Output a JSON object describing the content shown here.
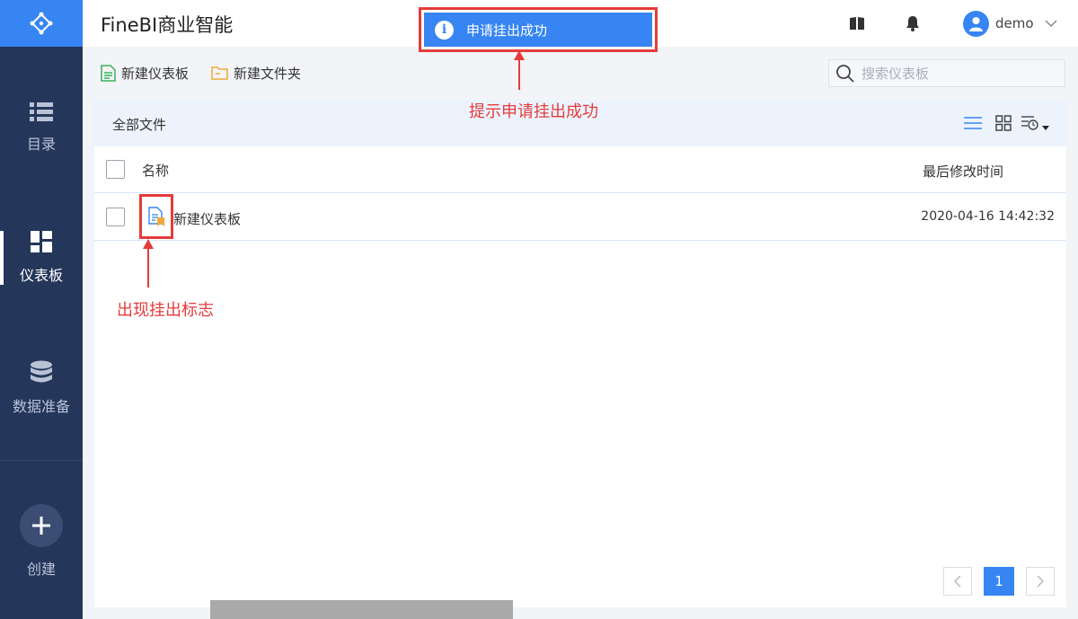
{
  "app": {
    "title": "FineBI商业智能",
    "brand_color": "#3685f2",
    "sidebar_color": "#24365a"
  },
  "sidebar": {
    "logo_icon": "finebi-logo-icon",
    "items": [
      {
        "label": "目录",
        "icon": "list-icon",
        "active": false
      },
      {
        "label": "仪表板",
        "icon": "dashboard-grid-icon",
        "active": true
      },
      {
        "label": "数据准备",
        "icon": "database-icon",
        "active": false
      }
    ],
    "create_label": "创建"
  },
  "header": {
    "help_icon": "book-icon",
    "bell_icon": "bell-icon",
    "username": "demo"
  },
  "toast": {
    "text": "申请挂出成功",
    "icon": "info-icon",
    "color": "#3685f2"
  },
  "toolbar": {
    "new_dashboard": "新建仪表板",
    "new_folder": "新建文件夹",
    "search_placeholder": "搜索仪表板"
  },
  "panel": {
    "breadcrumb": "全部文件",
    "columns": {
      "name": "名称",
      "modified": "最后修改时间"
    },
    "rows": [
      {
        "name": "新建仪表板",
        "modified": "2020-04-16 14:42:32",
        "published": true
      }
    ]
  },
  "annotations": {
    "toast_note": "提示申请挂出成功",
    "icon_note": "出现挂出标志",
    "color": "#e53b3b"
  },
  "pagination": {
    "current_page": "1"
  }
}
